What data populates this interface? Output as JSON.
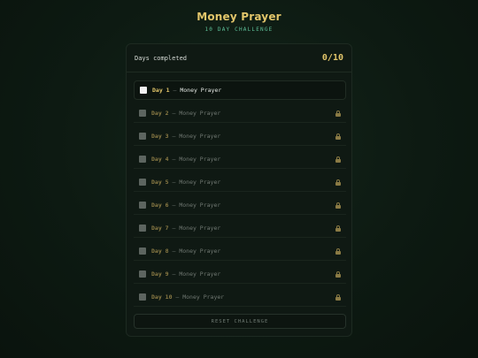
{
  "header": {
    "title": "Money Prayer",
    "subtitle": "10 DAY CHALLENGE"
  },
  "progress": {
    "label": "Days completed",
    "count_text": "0/10",
    "completed": 0,
    "total": 10
  },
  "days": [
    {
      "num": "Day 1",
      "sep": " — ",
      "name": "Money Prayer",
      "state": "active"
    },
    {
      "num": "Day 2",
      "sep": " — ",
      "name": "Money Prayer",
      "state": "locked"
    },
    {
      "num": "Day 3",
      "sep": " — ",
      "name": "Money Prayer",
      "state": "locked"
    },
    {
      "num": "Day 4",
      "sep": " — ",
      "name": "Money Prayer",
      "state": "locked"
    },
    {
      "num": "Day 5",
      "sep": " — ",
      "name": "Money Prayer",
      "state": "locked"
    },
    {
      "num": "Day 6",
      "sep": " — ",
      "name": "Money Prayer",
      "state": "locked"
    },
    {
      "num": "Day 7",
      "sep": " — ",
      "name": "Money Prayer",
      "state": "locked"
    },
    {
      "num": "Day 8",
      "sep": " — ",
      "name": "Money Prayer",
      "state": "locked"
    },
    {
      "num": "Day 9",
      "sep": " — ",
      "name": "Money Prayer",
      "state": "locked"
    },
    {
      "num": "Day 10",
      "sep": " — ",
      "name": "Money Prayer",
      "state": "locked"
    }
  ],
  "reset_label": "RESET CHALLENGE",
  "icons": {
    "locked_day": "lock-icon"
  },
  "colors": {
    "accent": "#e2c56a",
    "subtitle": "#5fc29a",
    "background": "#0d1a12"
  }
}
